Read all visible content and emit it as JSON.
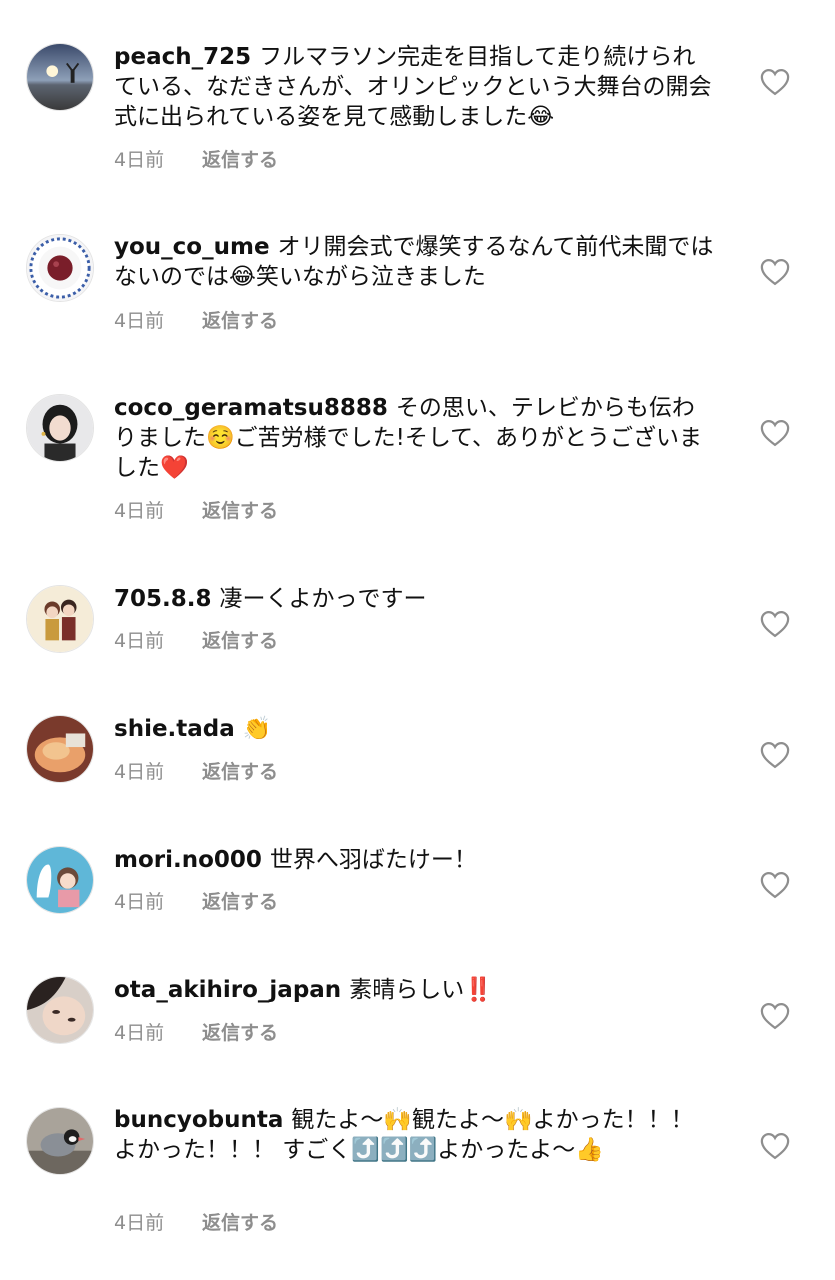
{
  "reply_label": "返信する",
  "comments": [
    {
      "username": "peach_725",
      "text": "フルマラソン完走を目指して走り続けられている、なだきさんが、オリンピックという大舞台の開会式に出られている姿を見て感動しました😂",
      "time": "4日前",
      "avatar_icon": "sunset-beach-avatar"
    },
    {
      "username": "you_co_ume",
      "text": "オリ開会式で爆笑するなんて前代未聞ではないのでは😂笑いながら泣きました",
      "time": "4日前",
      "avatar_icon": "umeboshi-plate-avatar"
    },
    {
      "username": "coco_geramatsu8888",
      "text": "その思い、テレビからも伝わりました☺️ご苦労様でした!そして、ありがとうございました❤️",
      "time": "4日前",
      "avatar_icon": "person-portrait-avatar"
    },
    {
      "username": "705.8.8",
      "text": "凄ーくよかっですー",
      "time": "4日前",
      "avatar_icon": "couple-illustration-avatar"
    },
    {
      "username": "shie.tada",
      "text": "👏",
      "time": "4日前",
      "avatar_icon": "food-photo-avatar"
    },
    {
      "username": "mori.no000",
      "text": "世界へ羽ばたけー！",
      "time": "4日前",
      "avatar_icon": "girl-illustration-avatar"
    },
    {
      "username": "ota_akihiro_japan",
      "text": "素晴らしい‼️",
      "time": "4日前",
      "avatar_icon": "face-closeup-avatar"
    },
    {
      "username": "buncyobunta",
      "text": "観たよ〜🙌観たよ〜🙌よかった！！！よかった！！！ すごく⤴️⤴️⤴️よかったよ〜👍",
      "time": "4日前",
      "avatar_icon": "java-sparrow-avatar"
    }
  ]
}
